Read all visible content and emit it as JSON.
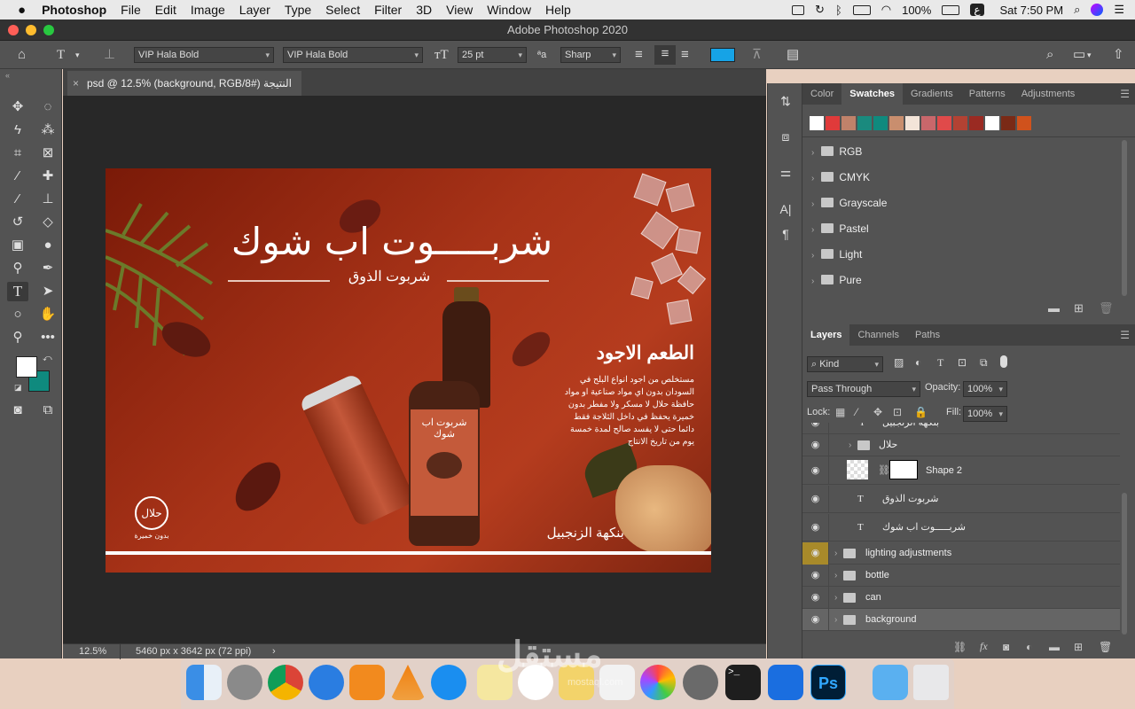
{
  "menubar": {
    "apple": "",
    "items": [
      "Photoshop",
      "File",
      "Edit",
      "Image",
      "Layer",
      "Type",
      "Select",
      "Filter",
      "3D",
      "View",
      "Window",
      "Help"
    ],
    "battery": "100%",
    "badge": "ع",
    "clock": "Sat 7:50 PM"
  },
  "window": {
    "title": "Adobe Photoshop 2020"
  },
  "options": {
    "font_family": "VIP Hala Bold",
    "font_style": "VIP Hala Bold",
    "font_size": "25 pt",
    "aa_label": "ªa",
    "antialias": "Sharp",
    "text_color": "#16a3e6"
  },
  "document": {
    "tab": "psd @ 12.5% (background, RGB/8#) النتيجة",
    "zoom": "12.5%",
    "info": "5460 px x 3642 px (72 ppi)"
  },
  "artwork": {
    "headline": "شربـــــوت اب شوك",
    "subhead": "شربوت الذوق",
    "taste_title": "الطعم الاجود",
    "body": "مستخلص من اجود انواع البلح في السودان بدون اي مواد صناعية او مواد حافظة حلال لا مسكر ولا مفطر بدون خميرة يحفظ في داخل الثلاجة فقط دائما حتى لا يفسد صالح لمدة خمسة يوم من تاريخ الانتاج",
    "flavor": "بنكهة الزنجبيل",
    "halal": "حلال",
    "no_yeast": "بدون خميرة",
    "bottle_label": "شربوت اب شوك"
  },
  "colors": {
    "fg": "#ffffff",
    "bg": "#0f8a7e"
  },
  "color_panel": {
    "tabs": [
      "Color",
      "Swatches",
      "Gradients",
      "Patterns",
      "Adjustments"
    ],
    "active": "Swatches",
    "swatches": [
      "#ffffff",
      "#e03a3a",
      "#c0826a",
      "#1a8a7e",
      "#0f8a7e",
      "#c98e6e",
      "#f3e4d8",
      "#c9676b",
      "#e04a4a",
      "#b34233",
      "#9a2a22",
      "#ffffff",
      "#7a2a16",
      "#d0521c"
    ],
    "groups": [
      "RGB",
      "CMYK",
      "Grayscale",
      "Pastel",
      "Light",
      "Pure"
    ]
  },
  "layers_panel": {
    "tabs": [
      "Layers",
      "Channels",
      "Paths"
    ],
    "active": "Layers",
    "filter": "Kind",
    "blend": "Pass Through",
    "opacity_label": "Opacity:",
    "opacity": "100%",
    "lock_label": "Lock:",
    "fill_label": "Fill:",
    "fill": "100%",
    "rows": [
      {
        "name": "بنكهة الزنجبيل",
        "kind": "text"
      },
      {
        "name": "حلال",
        "kind": "group"
      },
      {
        "name": "Shape 2",
        "kind": "shape"
      },
      {
        "name": "شربوت الذوق",
        "kind": "text"
      },
      {
        "name": "شربـــــوت اب شوك",
        "kind": "text"
      },
      {
        "name": "lighting adjustments",
        "kind": "group"
      },
      {
        "name": "bottle",
        "kind": "group"
      },
      {
        "name": "can",
        "kind": "group"
      },
      {
        "name": "background",
        "kind": "group"
      }
    ]
  },
  "watermark": "مستقل",
  "watermark_sub": "mostaql.com"
}
